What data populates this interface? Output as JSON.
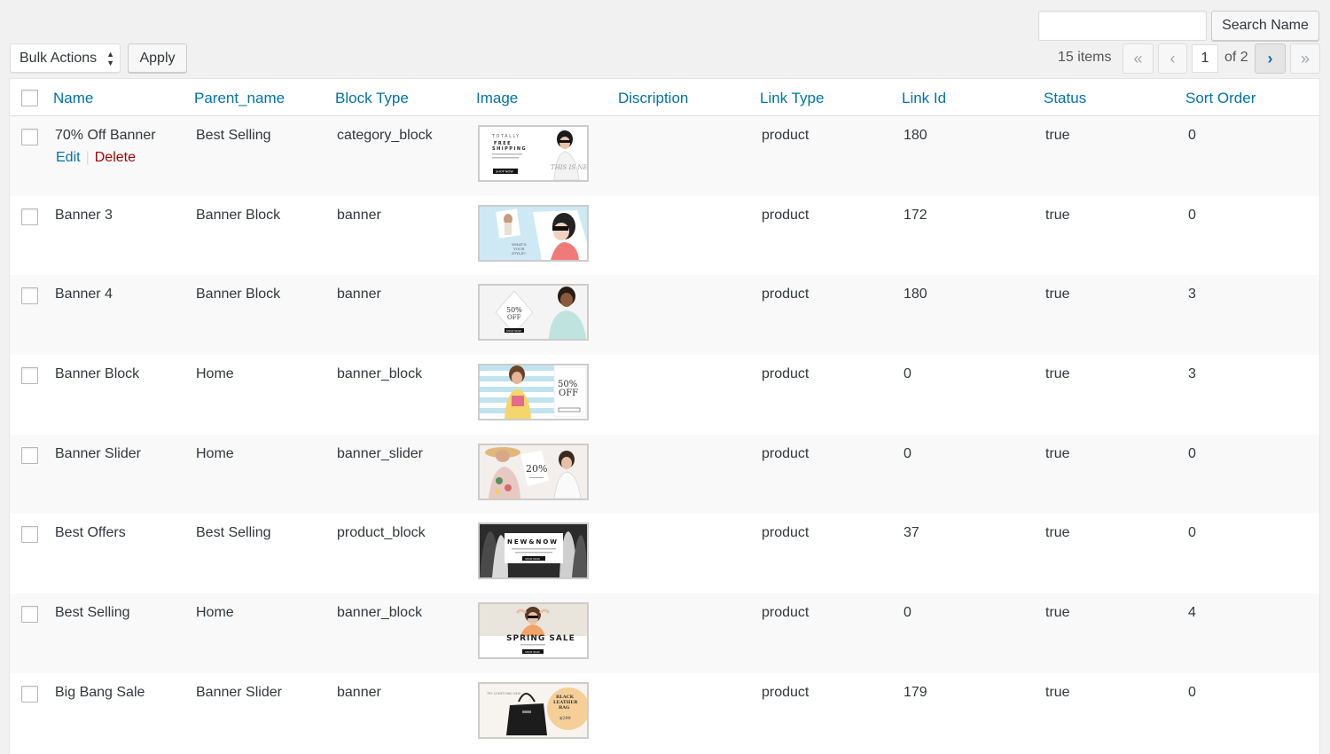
{
  "search": {
    "placeholder": "",
    "button_label": "Search Name"
  },
  "bulk": {
    "selected": "Bulk Actions",
    "apply_label": "Apply"
  },
  "pagination": {
    "items_text": "15 items",
    "first": "«",
    "prev": "‹",
    "current": "1",
    "of_text": "of 2",
    "next": "›",
    "last": "»"
  },
  "columns": [
    "Name",
    "Parent_name",
    "Block Type",
    "Image",
    "Discription",
    "Link Type",
    "Link Id",
    "Status",
    "Sort Order"
  ],
  "row_actions": {
    "edit": "Edit",
    "sep": "|",
    "delete": "Delete"
  },
  "rows": [
    {
      "name": "70% Off Banner",
      "parent": "Best Selling",
      "block_type": "category_block",
      "image": "free-shipping-banner",
      "description": "",
      "link_type": "product",
      "link_id": "180",
      "status": "true",
      "sort": "0",
      "image_text": {
        "a": "TOTALLY",
        "b": "FREE",
        "c": "SHIPPING",
        "btn": "SHOP NOW",
        "side": "THIS IS NEW"
      }
    },
    {
      "name": "Banner 3",
      "parent": "Banner Block",
      "block_type": "banner",
      "image": "whats-your-style-banner",
      "description": "",
      "link_type": "product",
      "link_id": "172",
      "status": "true",
      "sort": "0",
      "image_text": {
        "a": "WHAT'S",
        "b": "YOUR",
        "c": "STYLE?"
      }
    },
    {
      "name": "Banner 4",
      "parent": "Banner Block",
      "block_type": "banner",
      "image": "fifty-off-banner",
      "description": "",
      "link_type": "product",
      "link_id": "180",
      "status": "true",
      "sort": "3",
      "image_text": {
        "a": "50%",
        "b": "OFF",
        "btn": "SHOP NOW"
      }
    },
    {
      "name": "Banner Block",
      "parent": "Home",
      "block_type": "banner_block",
      "image": "striped-fifty-off-banner",
      "description": "",
      "link_type": "product",
      "link_id": "0",
      "status": "true",
      "sort": "3",
      "image_text": {
        "a": "50%",
        "b": "OFF"
      }
    },
    {
      "name": "Banner Slider",
      "parent": "Home",
      "block_type": "banner_slider",
      "image": "twenty-off-banner",
      "description": "",
      "link_type": "product",
      "link_id": "0",
      "status": "true",
      "sort": "0",
      "image_text": {
        "a": "20%"
      }
    },
    {
      "name": "Best Offers",
      "parent": "Best Selling",
      "block_type": "product_block",
      "image": "new-and-now-banner",
      "description": "",
      "link_type": "product",
      "link_id": "37",
      "status": "true",
      "sort": "0",
      "image_text": {
        "a": "NEW&NOW",
        "btn": "SHOP NOW"
      }
    },
    {
      "name": "Best Selling",
      "parent": "Home",
      "block_type": "banner_block",
      "image": "spring-sale-banner",
      "description": "",
      "link_type": "product",
      "link_id": "0",
      "status": "true",
      "sort": "4",
      "image_text": {
        "a": "SPRING SALE",
        "btn": "SHOP NOW"
      }
    },
    {
      "name": "Big Bang Sale",
      "parent": "Banner Slider",
      "block_type": "banner",
      "image": "black-leather-bag-banner",
      "description": "",
      "link_type": "product",
      "link_id": "179",
      "status": "true",
      "sort": "0",
      "image_text": {
        "a": "TRY SOMETHING NEW",
        "b": "BLACK",
        "c": "LEATHER",
        "d": "BAG",
        "price": "$299"
      }
    }
  ],
  "colors": {
    "link": "#0073aa",
    "delete": "#aa0000",
    "text": "#32373c",
    "bg": "#f1f1f1"
  }
}
